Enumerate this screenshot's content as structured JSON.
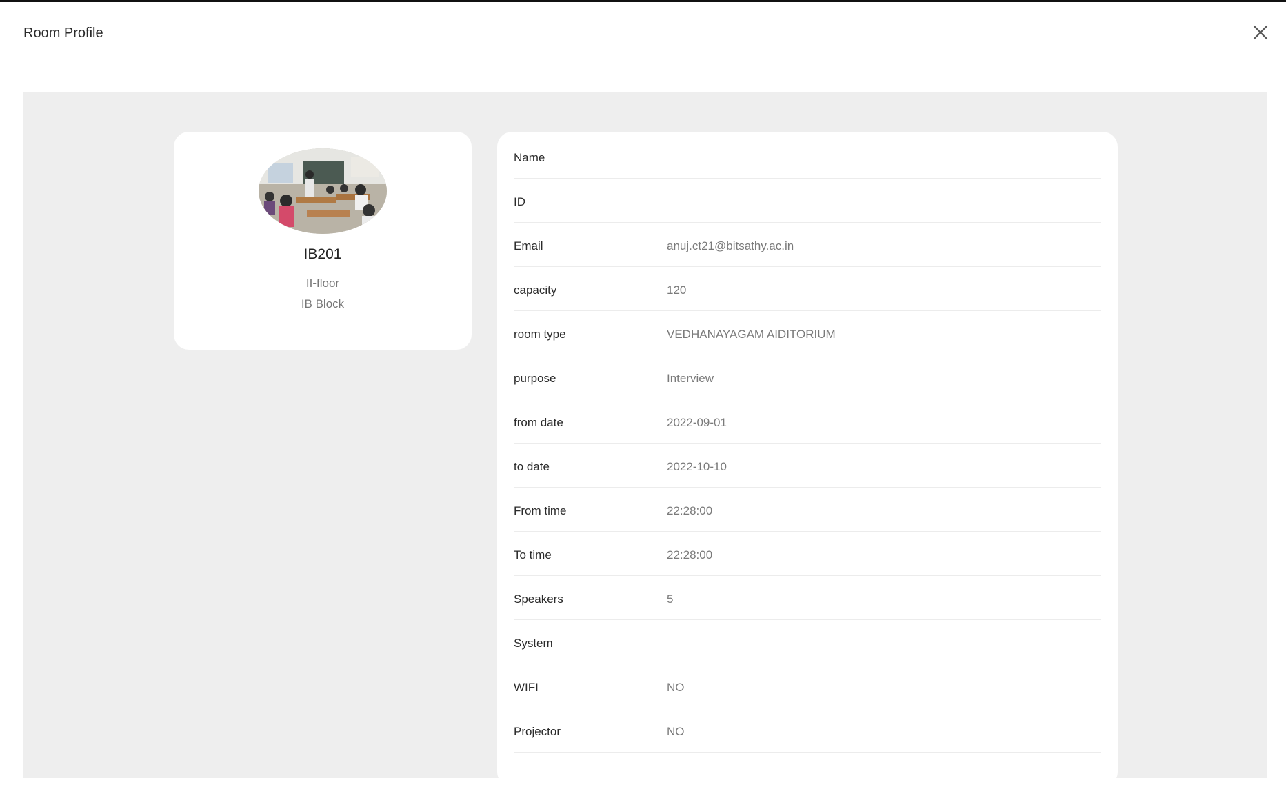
{
  "modal": {
    "title": "Room Profile",
    "close_icon": "close-icon"
  },
  "profile": {
    "photo_icon": "classroom-photo",
    "name": "IB201",
    "floor": "II-floor",
    "block": "IB Block"
  },
  "details": [
    {
      "label": "Name",
      "value": ""
    },
    {
      "label": "ID",
      "value": ""
    },
    {
      "label": "Email",
      "value": "anuj.ct21@bitsathy.ac.in"
    },
    {
      "label": "capacity",
      "value": "120"
    },
    {
      "label": "room type",
      "value": "VEDHANAYAGAM AIDITORIUM"
    },
    {
      "label": "purpose",
      "value": "Interview"
    },
    {
      "label": "from date",
      "value": "2022-09-01"
    },
    {
      "label": "to date",
      "value": "2022-10-10"
    },
    {
      "label": "From time",
      "value": "22:28:00"
    },
    {
      "label": "To time",
      "value": "22:28:00"
    },
    {
      "label": "Speakers",
      "value": "5"
    },
    {
      "label": "System",
      "value": ""
    },
    {
      "label": "WIFI",
      "value": "NO"
    },
    {
      "label": "Projector",
      "value": "NO"
    }
  ]
}
